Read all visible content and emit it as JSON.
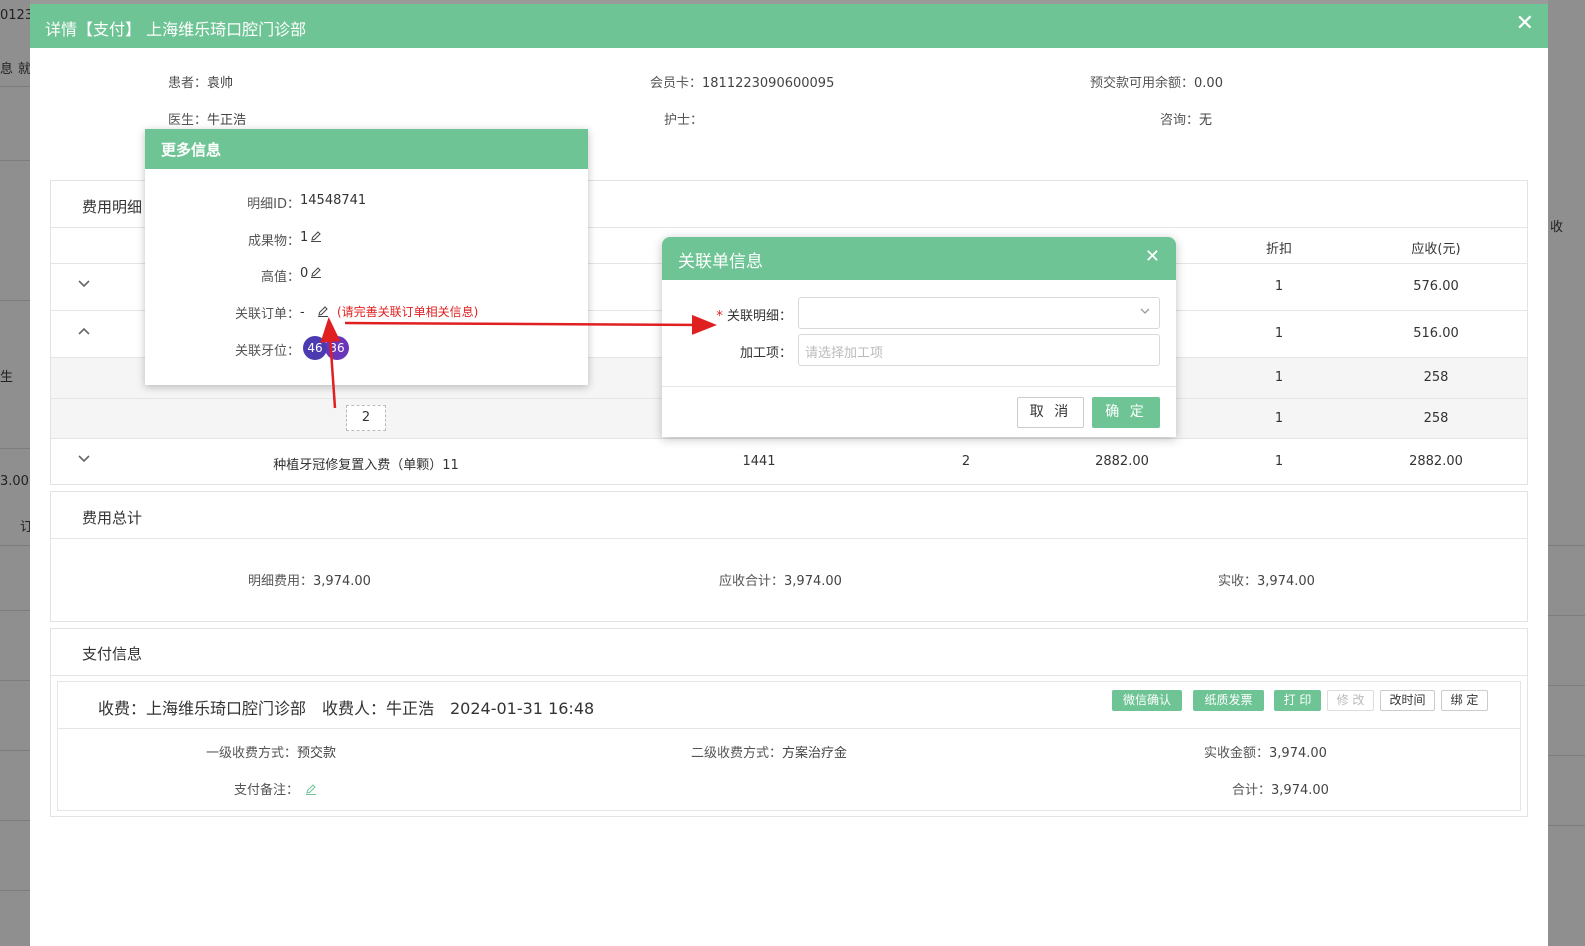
{
  "dialog": {
    "title": "详情【支付】 上海维乐琦口腔门诊部"
  },
  "patient": {
    "patient_label": "患者：",
    "patient_value": "袁帅",
    "card_label": "会员卡：",
    "card_value": "1811223090600095",
    "balance_label": "预交款可用余额：",
    "balance_value": "0.00",
    "doctor_label": "医生：",
    "doctor_value": "牛正浩",
    "nurse_label": "护士：",
    "nurse_value": "",
    "consult_label": "咨询：",
    "consult_value": "无"
  },
  "fee_detail": {
    "title": "费用明细",
    "headers": {
      "discount": "折扣",
      "receivable": "应收(元)"
    },
    "rows": [
      {
        "discount": "1",
        "receivable": "576.00"
      },
      {
        "discount": "1",
        "receivable": "516.00"
      },
      {
        "discount": "1",
        "receivable": "258"
      },
      {
        "qty": "2",
        "discount": "1",
        "receivable": "258"
      },
      {
        "name": "种植牙冠修复置入费（单颗）11",
        "price": "1441",
        "qty": "2",
        "amount": "2882.00",
        "discount": "1",
        "receivable": "2882.00"
      }
    ]
  },
  "fee_total": {
    "title": "费用总计",
    "detail_label": "明细费用：",
    "detail_value": "3,974.00",
    "receivable_label": "应收合计：",
    "receivable_value": "3,974.00",
    "actual_label": "实收：",
    "actual_value": "3,974.00"
  },
  "payment": {
    "title": "支付信息",
    "header_line": "收费：上海维乐琦口腔门诊部　收费人：牛正浩　2024-01-31 16:48",
    "buttons": {
      "wechat": "微信确认",
      "invoice": "纸质发票",
      "print": "打 印",
      "modify": "修 改",
      "change_time": "改时间",
      "bind": "绑 定"
    },
    "level1_label": "一级收费方式：",
    "level1_value": "预交款",
    "level2_label": "二级收费方式：",
    "level2_value": "方案治疗金",
    "actual_amount_label": "实收金额：",
    "actual_amount_value": "3,974.00",
    "remark_label": "支付备注：",
    "total_label": "合计：",
    "total_value": "3,974.00"
  },
  "more_info": {
    "title": "更多信息",
    "detail_id_label": "明细ID：",
    "detail_id_value": "14548741",
    "result_label": "成果物：",
    "result_value": "1",
    "high_label": "高值：",
    "high_value": "0",
    "order_label": "关联订单：",
    "order_value": "-",
    "order_hint": "(请完善关联订单相关信息)",
    "tooth_label": "关联牙位：",
    "teeth": [
      "46",
      "36"
    ]
  },
  "link_dialog": {
    "title": "关联单信息",
    "detail_label": "关联明细：",
    "required_mark": "*",
    "process_label": "加工项：",
    "process_placeholder": "请选择加工项",
    "cancel": "取 消",
    "confirm": "确 定"
  },
  "background": {
    "texts": [
      "0123",
      "息",
      "就",
      "生",
      "3.00",
      "订",
      "收"
    ]
  },
  "colors": {
    "accent": "#6ec495",
    "tooth1": "#4b3ab0",
    "tooth2": "#6a35b8",
    "annotation": "#e02020"
  }
}
